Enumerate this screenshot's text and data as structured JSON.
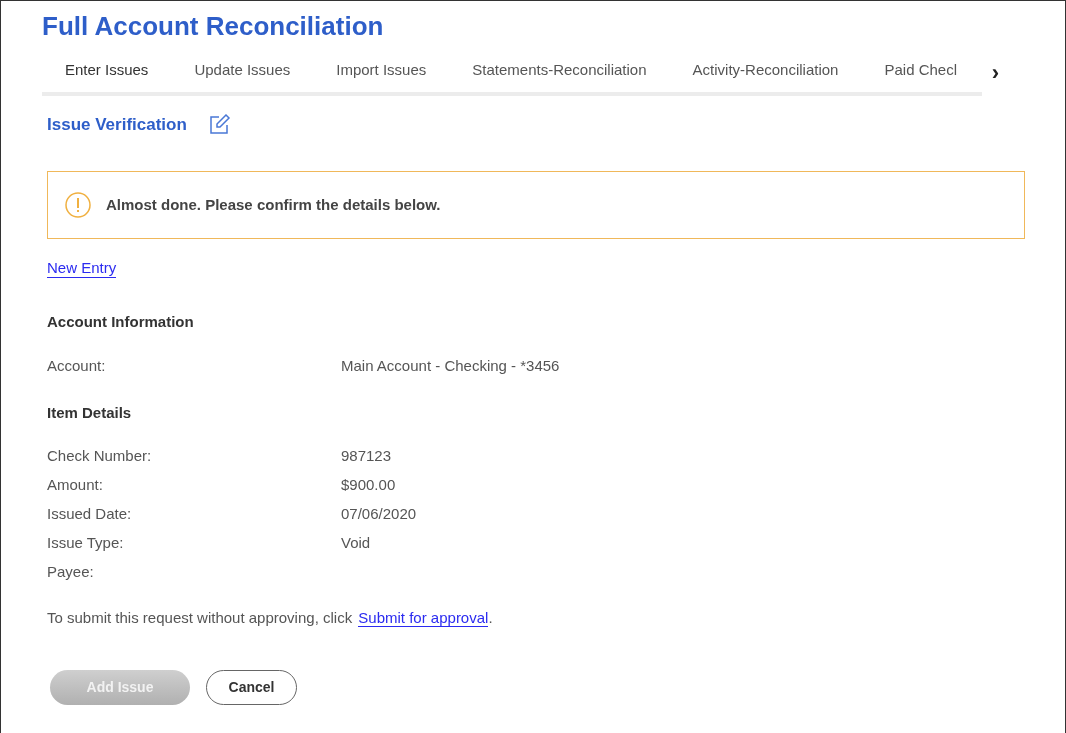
{
  "title": "Full Account Reconciliation",
  "tabs": [
    {
      "label": "Enter Issues",
      "selected": true
    },
    {
      "label": "Update Issues",
      "selected": false
    },
    {
      "label": "Import Issues",
      "selected": false
    },
    {
      "label": "Statements-Reconciliation",
      "selected": false
    },
    {
      "label": "Activity-Reconciliation",
      "selected": false
    },
    {
      "label": "Paid Checl",
      "selected": false
    }
  ],
  "tabs_next": "›",
  "section_title": "Issue Verification",
  "alert": {
    "message": "Almost done. Please confirm the details below."
  },
  "new_entry_link": "New Entry",
  "groups": [
    {
      "heading": "Account Information",
      "fields": [
        {
          "label": "Account:",
          "value": "Main Account - Checking - *3456"
        }
      ]
    },
    {
      "heading": "Item Details",
      "fields": [
        {
          "label": "Check Number:",
          "value": "987123"
        },
        {
          "label": "Amount:",
          "value": "$900.00"
        },
        {
          "label": "Issued Date:",
          "value": "07/06/2020"
        },
        {
          "label": "Issue Type:",
          "value": "Void"
        },
        {
          "label": "Payee:"
        }
      ]
    }
  ],
  "submit_note": {
    "text": "To submit this request without approving, click",
    "link": "Submit for approval",
    "end": "."
  },
  "buttons": [
    {
      "label": "Add Issue",
      "kind": "primary",
      "disabled": true
    },
    {
      "label": "Cancel",
      "kind": "secondary",
      "disabled": false
    }
  ]
}
